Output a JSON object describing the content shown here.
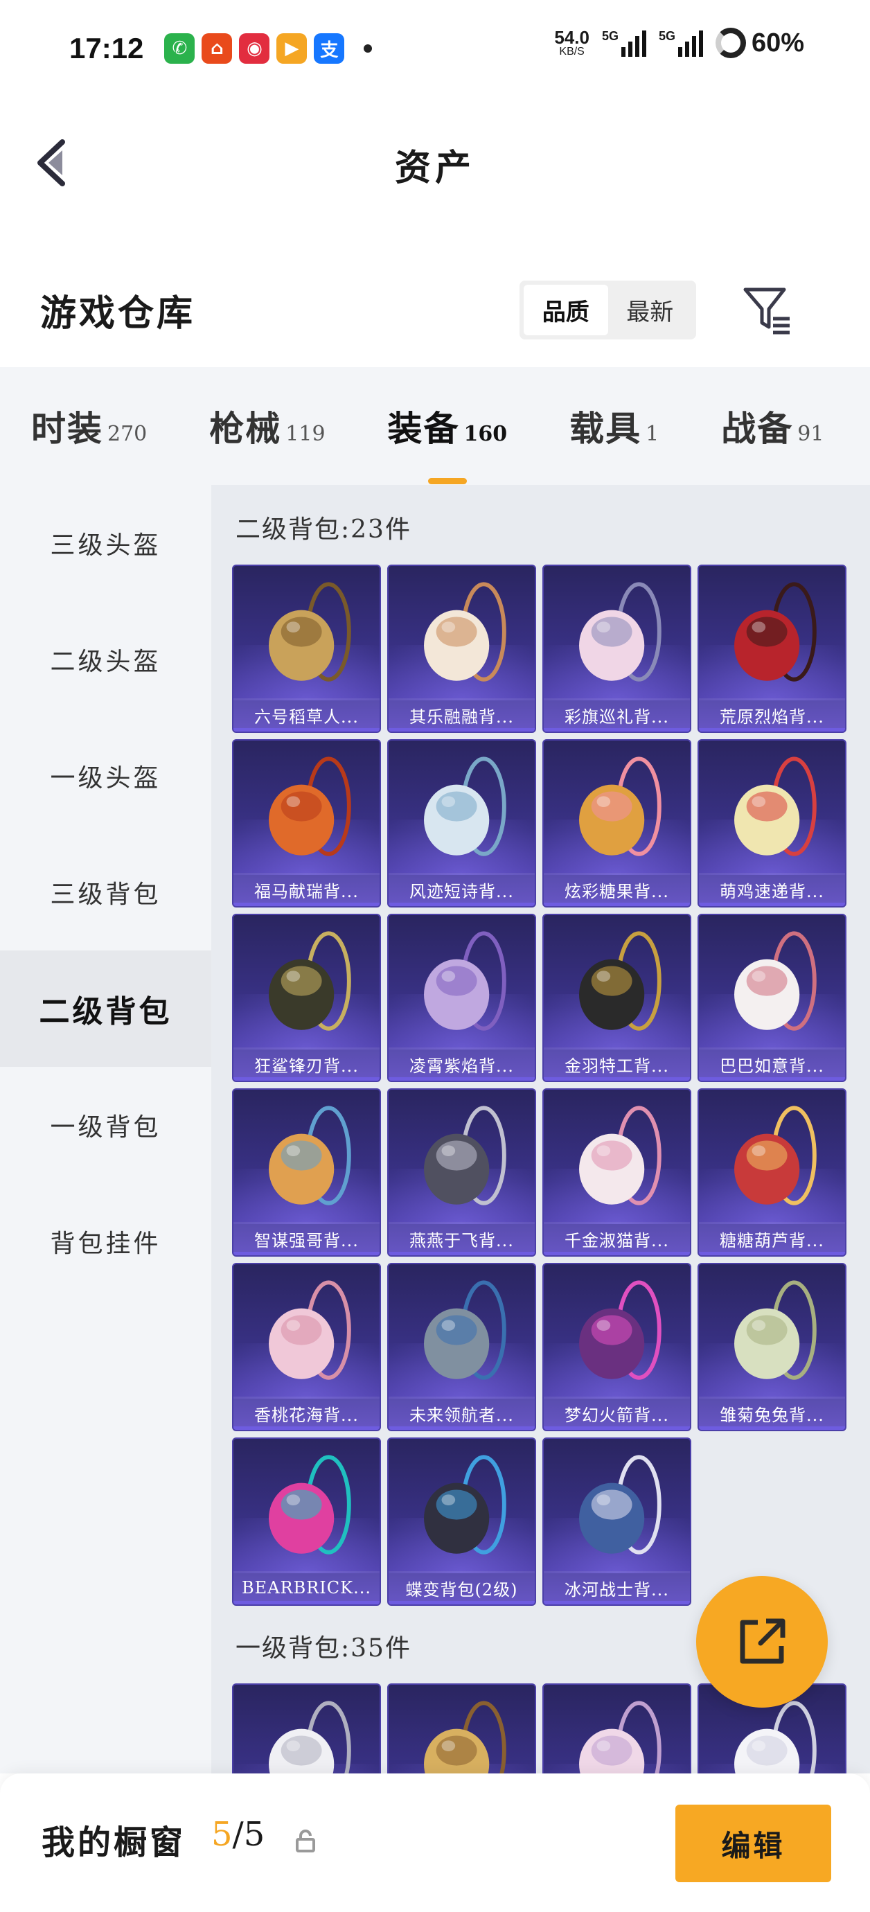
{
  "status": {
    "time": "17:12",
    "net_speed": "54.0",
    "net_unit": "KB/S",
    "signal1": "5G",
    "signal2": "5G",
    "battery": "60%"
  },
  "header": {
    "title": "资产"
  },
  "warehouse": {
    "title": "游戏仓库",
    "sort_options": [
      "品质",
      "最新"
    ],
    "active_sort": "品质"
  },
  "categories": [
    {
      "name": "时装",
      "count": "270"
    },
    {
      "name": "枪械",
      "count": "119"
    },
    {
      "name": "装备",
      "count": "160"
    },
    {
      "name": "载具",
      "count": "1"
    },
    {
      "name": "战备",
      "count": "91"
    }
  ],
  "active_category": "装备",
  "sidebar": {
    "items": [
      "三级头盔",
      "二级头盔",
      "一级头盔",
      "三级背包",
      "二级背包",
      "一级背包",
      "背包挂件"
    ],
    "active": "二级背包"
  },
  "sections": [
    {
      "title": "二级背包:23件",
      "items": [
        "六号稻草人...",
        "其乐融融背...",
        "彩旗巡礼背...",
        "荒原烈焰背...",
        "福马献瑞背...",
        "风迹短诗背...",
        "炫彩糖果背...",
        "萌鸡速递背...",
        "狂鲨锋刃背...",
        "凌霄紫焰背...",
        "金羽特工背...",
        "巴巴如意背...",
        "智谋强哥背...",
        "燕燕于飞背...",
        "千金淑猫背...",
        "糖糖葫芦背...",
        "香桃花海背...",
        "未来领航者...",
        "梦幻火箭背...",
        "雏菊兔兔背...",
        "BEARBRICK...",
        "蝶变背包(2级)",
        "冰河战士背..."
      ]
    },
    {
      "title": "一级背包:35件",
      "items": [
        "",
        "",
        "",
        ""
      ]
    }
  ],
  "showcase": {
    "label": "我的橱窗",
    "current": "5",
    "total": "/5",
    "edit_label": "编辑"
  },
  "colors": {
    "accent": "#f7a823",
    "card_bg": "#3a3288"
  }
}
